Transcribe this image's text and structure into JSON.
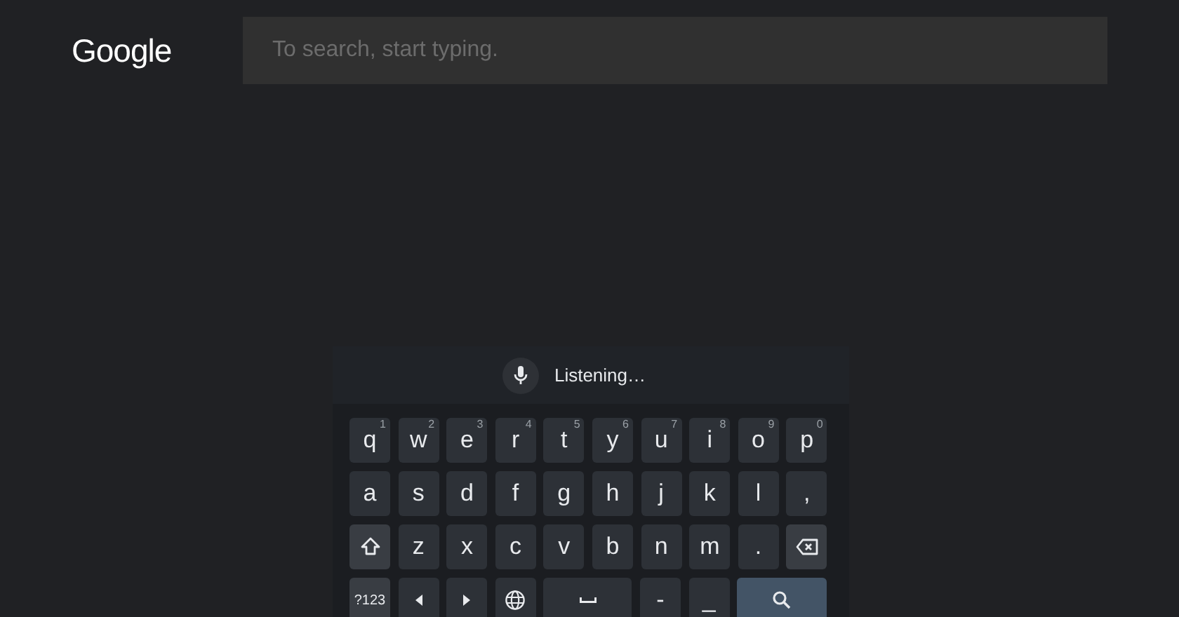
{
  "header": {
    "logo": "Google",
    "search": {
      "placeholder": "To search, start typing."
    }
  },
  "voice_bar": {
    "status": "Listening…"
  },
  "keyboard": {
    "rows": [
      {
        "keys": [
          {
            "kind": "char",
            "label": "q",
            "hint": "1"
          },
          {
            "kind": "char",
            "label": "w",
            "hint": "2"
          },
          {
            "kind": "char",
            "label": "e",
            "hint": "3"
          },
          {
            "kind": "char",
            "label": "r",
            "hint": "4"
          },
          {
            "kind": "char",
            "label": "t",
            "hint": "5"
          },
          {
            "kind": "char",
            "label": "y",
            "hint": "6"
          },
          {
            "kind": "char",
            "label": "u",
            "hint": "7"
          },
          {
            "kind": "char",
            "label": "i",
            "hint": "8"
          },
          {
            "kind": "char",
            "label": "o",
            "hint": "9"
          },
          {
            "kind": "char",
            "label": "p",
            "hint": "0"
          }
        ]
      },
      {
        "keys": [
          {
            "kind": "char",
            "label": "a"
          },
          {
            "kind": "char",
            "label": "s"
          },
          {
            "kind": "char",
            "label": "d"
          },
          {
            "kind": "char",
            "label": "f"
          },
          {
            "kind": "char",
            "label": "g"
          },
          {
            "kind": "char",
            "label": "h"
          },
          {
            "kind": "char",
            "label": "j"
          },
          {
            "kind": "char",
            "label": "k"
          },
          {
            "kind": "char",
            "label": "l"
          },
          {
            "kind": "char",
            "label": ","
          }
        ]
      },
      {
        "keys": [
          {
            "kind": "shift"
          },
          {
            "kind": "char",
            "label": "z"
          },
          {
            "kind": "char",
            "label": "x"
          },
          {
            "kind": "char",
            "label": "c"
          },
          {
            "kind": "char",
            "label": "v"
          },
          {
            "kind": "char",
            "label": "b"
          },
          {
            "kind": "char",
            "label": "n"
          },
          {
            "kind": "char",
            "label": "m"
          },
          {
            "kind": "char",
            "label": "."
          },
          {
            "kind": "backspace"
          }
        ]
      },
      {
        "keys": [
          {
            "kind": "symbols",
            "label": "?123"
          },
          {
            "kind": "left"
          },
          {
            "kind": "right"
          },
          {
            "kind": "globe"
          },
          {
            "kind": "space"
          },
          {
            "kind": "char",
            "label": "-"
          },
          {
            "kind": "char",
            "label": "_"
          },
          {
            "kind": "search"
          }
        ]
      }
    ]
  }
}
